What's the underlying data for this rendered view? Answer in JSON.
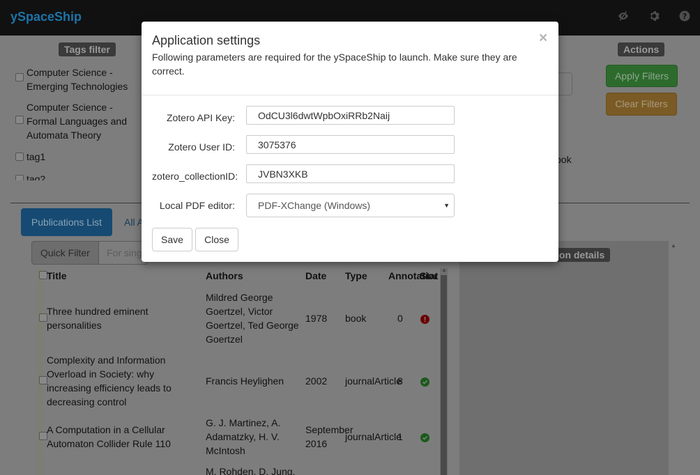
{
  "navbar": {
    "brand": "ySpaceShip",
    "icons": [
      "eye-slash-icon",
      "gear-icon",
      "question-icon"
    ]
  },
  "background": {
    "tags_filter_label": "Tags filter",
    "actions_label": "Actions",
    "apply_filters": "Apply Filters",
    "clear_filters": "Clear Filters",
    "search_placeholder_fragment": "o",
    "book_fragment": "ook",
    "tags": [
      {
        "label": "Computer Science - Emerging Technologies"
      },
      {
        "label": "Computer Science - Formal Languages and Automata Theory"
      },
      {
        "label": "tag1"
      },
      {
        "label": "tag2"
      }
    ],
    "tabs": {
      "publications": "Publications List",
      "all_a": "All A"
    },
    "quick_filter": "Quick Filter",
    "quick_filter_placeholder": "For sing",
    "details_label": "ion details",
    "table": {
      "headers": {
        "title": "Title",
        "authors": "Authors",
        "date": "Date",
        "type": "Type",
        "annotations": "Annotations",
        "status": "Stat"
      },
      "rows": [
        {
          "title": "Three hundred eminent personalities",
          "authors": "Mildred George Goertzel, Victor Goertzel, Ted George Goertzel",
          "date": "1978",
          "type": "book",
          "annotations": "0",
          "status": "error"
        },
        {
          "title": "Complexity and Information Overload in Society: why increasing efficiency leads to decreasing control",
          "authors": "Francis Heylighen",
          "date": "2002",
          "type": "journalArticle",
          "annotations": "8",
          "status": "ok"
        },
        {
          "title": "A Computation in a Cellular Automaton Collider Rule 110",
          "authors": "G. J. Martinez, A. Adamatzky, H. V. McIntosh",
          "date": "September 2016",
          "type": "journalArticle",
          "annotations": "1",
          "status": "ok"
        },
        {
          "title": "",
          "authors": "M. Rohden, D. Jung,",
          "date": "",
          "type": "",
          "annotations": "",
          "status": ""
        }
      ]
    }
  },
  "modal": {
    "title": "Application settings",
    "description": "Following parameters are required for the ySpaceShip to launch. Make sure they are correct.",
    "close_symbol": "×",
    "fields": {
      "api_key_label": "Zotero API Key:",
      "api_key_value": "OdCU3l6dwtWpbOxiRRb2Naij",
      "user_id_label": "Zotero User ID:",
      "user_id_value": "3075376",
      "collection_label": "zotero_collectionID:",
      "collection_value": "JVBN3XKB",
      "pdf_editor_label": "Local PDF editor:",
      "pdf_editor_value": "PDF-XChange (Windows)"
    },
    "save_label": "Save",
    "close_label": "Close"
  }
}
